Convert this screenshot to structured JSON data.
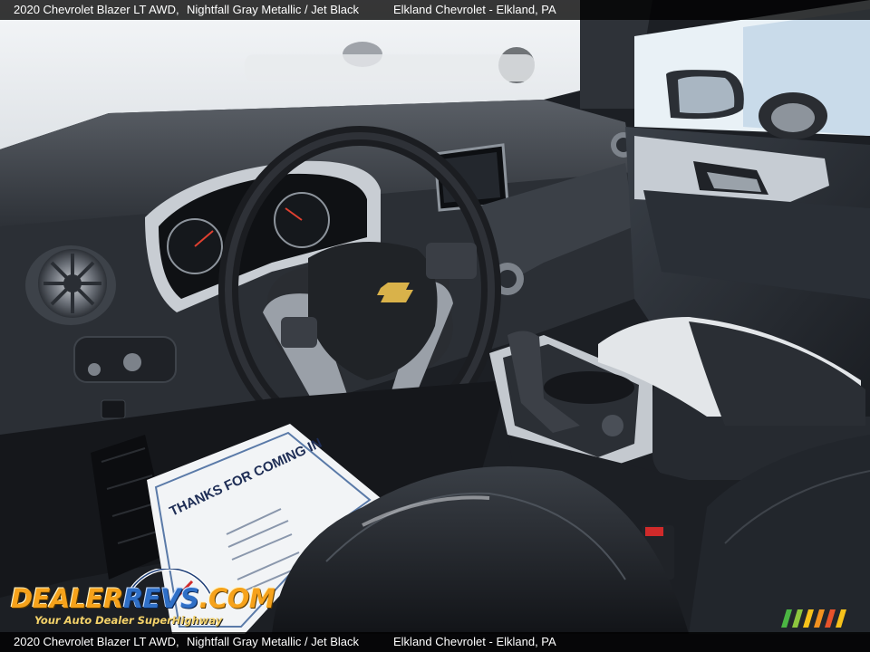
{
  "caption": {
    "vehicle": "2020 Chevrolet Blazer LT AWD,",
    "color": "Nightfall Gray Metallic / Jet Black",
    "dealer": "Elkland Chevrolet - Elkland, PA"
  },
  "watermark": {
    "logo_text": "DealerRevs.com",
    "tagline": "Your Auto Dealer SuperHighway"
  },
  "mat_text": {
    "headline": "THANKS FOR COMING IN"
  },
  "colors": {
    "logo_orange": "#f6a21b",
    "logo_blue": "#2f6fc6",
    "caption_bar": "#000000",
    "cabin_black": "#1c1f24"
  }
}
